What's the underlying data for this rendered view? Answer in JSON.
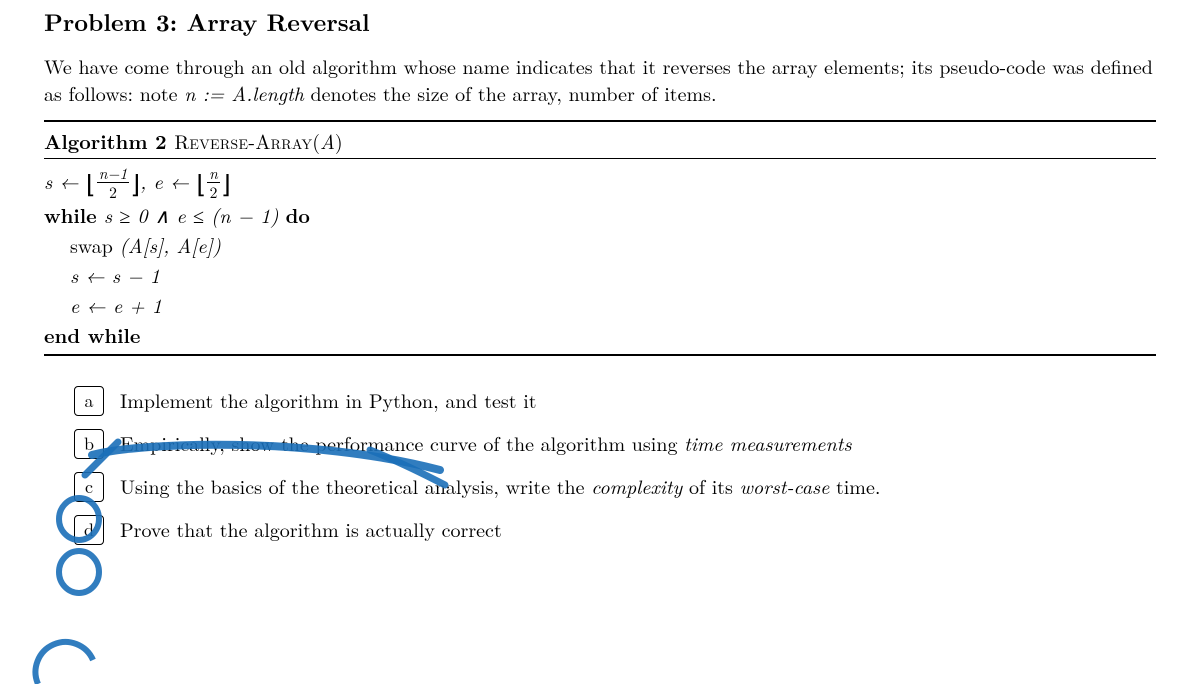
{
  "title": "Problem 3: Array Reversal",
  "intro_1": "We have come through an old algorithm whose name indicates that it reverses the array elements; its pseudo-code was defined as follows: note ",
  "intro_var": "n := A.length",
  "intro_2": " denotes the size of the array, number of items.",
  "algo": {
    "number_label": "Algorithm 2",
    "name": "Reverse-Array",
    "arg": "A",
    "lines": {
      "init_s_lhs": "s ← ",
      "floor_n_minus_1_over_2_num": "n−1",
      "floor_n_minus_1_over_2_den": "2",
      "init_e_lhs": ", e ← ",
      "floor_n_over_2_num": "n",
      "floor_n_over_2_den": "2",
      "while_kw": "while",
      "while_cond": " s ≥ 0 ∧ e ≤ (n − 1) ",
      "do_kw": "do",
      "swap": "swap (A[s], A[e])",
      "update_s": "s ← s − 1",
      "update_e": "e ← e + 1",
      "end": "end while"
    }
  },
  "parts": {
    "a": {
      "marker": "a",
      "text": "Implement the algorithm in Python, and test it"
    },
    "b": {
      "marker": "b",
      "prefix": "Empirically, show the performance curve of the algorithm using ",
      "em": "time measurements"
    },
    "c": {
      "marker": "c",
      "prefix": "Using the basics of the theoretical analysis, write the ",
      "em1": "complexity",
      "mid": " of its ",
      "em2": "worst-case",
      "suffix": " time."
    },
    "d": {
      "marker": "d",
      "text": "Prove that the algorithm is actually correct"
    }
  }
}
